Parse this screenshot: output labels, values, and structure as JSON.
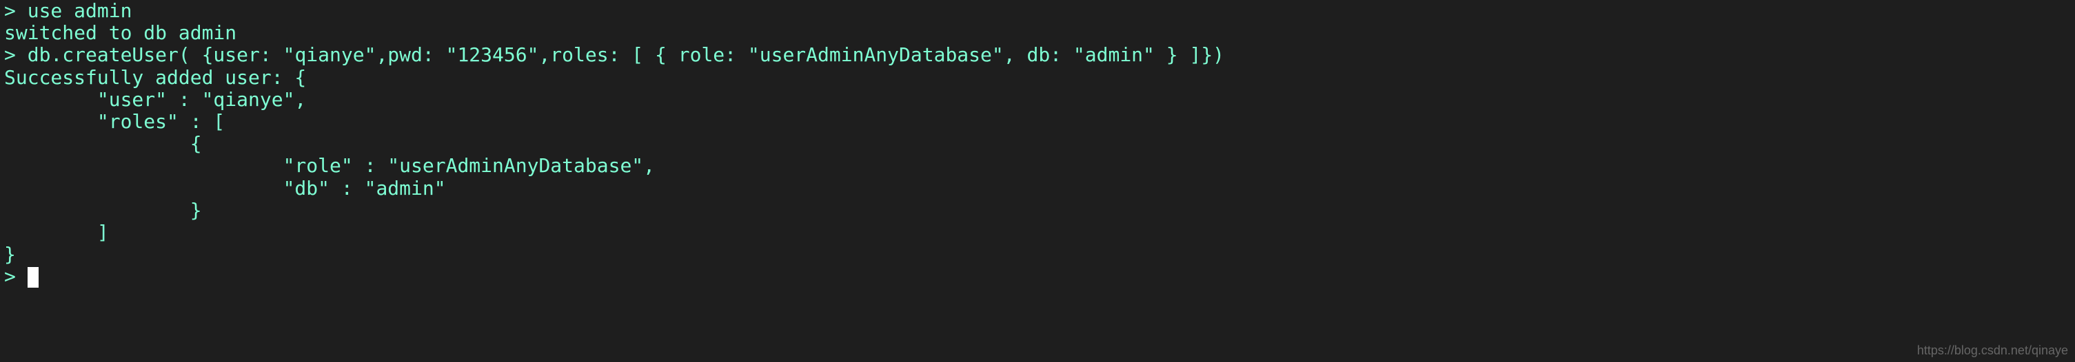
{
  "terminal": {
    "lines": {
      "l1_prompt": ">",
      "l1_cmd": " use admin",
      "l2": "switched to db admin",
      "l3_prompt": ">",
      "l3_cmd": " db.createUser( {user: \"qianye\",pwd: \"123456\",roles: [ { role: \"userAdminAnyDatabase\", db: \"admin\" } ]})",
      "l4": "Successfully added user: {",
      "l5": "        \"user\" : \"qianye\",",
      "l6": "        \"roles\" : [",
      "l7": "                {",
      "l8": "                        \"role\" : \"userAdminAnyDatabase\",",
      "l9": "                        \"db\" : \"admin\"",
      "l10": "                }",
      "l11": "        ]",
      "l12": "}",
      "l13_prompt": ">",
      "l13_space": " "
    }
  },
  "watermark": "https://blog.csdn.net/qinaye"
}
